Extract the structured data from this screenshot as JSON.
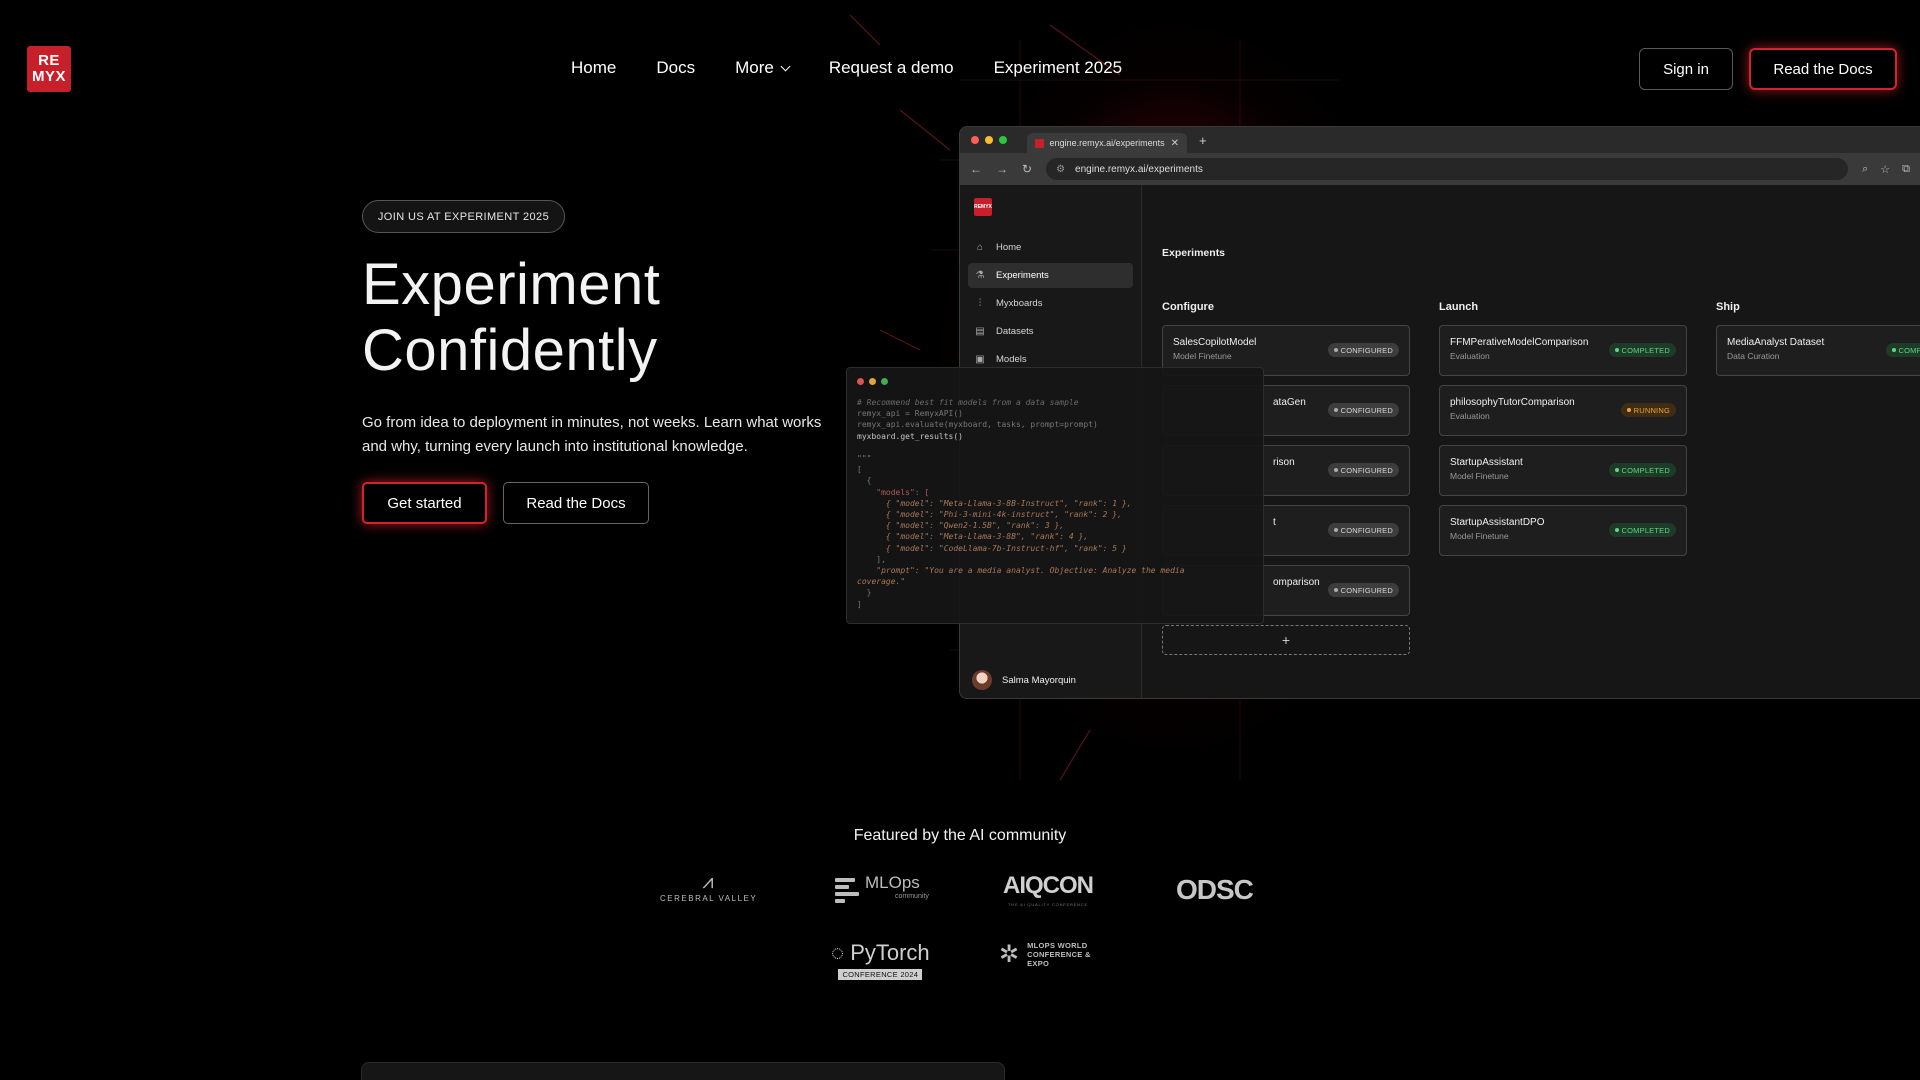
{
  "brand": {
    "logo_line1": "RE",
    "logo_line2": "MYX",
    "accent": "#d2232e"
  },
  "nav": {
    "items": [
      "Home",
      "Docs",
      "More",
      "Request a demo",
      "Experiment 2025"
    ],
    "sign_in": "Sign in",
    "read_docs": "Read the Docs"
  },
  "hero": {
    "pill": "JOIN US AT EXPERIMENT 2025",
    "title_line1": "Experiment",
    "title_line2": "Confidently",
    "subtitle": "Go from idea to deployment in minutes, not weeks. Learn what works and why, turning every launch into institutional knowledge.",
    "cta_primary": "Get started",
    "cta_secondary": "Read the Docs"
  },
  "browser": {
    "tab_title": "engine.remyx.ai/experiments",
    "url": "engine.remyx.ai/experiments",
    "app_logo_line1": "RE",
    "app_logo_line2": "MYX",
    "sidebar": [
      {
        "label": "Home",
        "icon": "home-icon"
      },
      {
        "label": "Experiments",
        "icon": "flask-icon"
      },
      {
        "label": "Myxboards",
        "icon": "sliders-icon"
      },
      {
        "label": "Datasets",
        "icon": "document-icon"
      },
      {
        "label": "Models",
        "icon": "cube-icon"
      }
    ],
    "user_name": "Salma Mayorquin",
    "page_title": "Experiments",
    "columns": {
      "configure": {
        "title": "Configure",
        "cards": [
          {
            "name": "SalesCopilotModel",
            "sub": "Model Finetune",
            "status": "CONFIGURED"
          },
          {
            "name": "ataGen",
            "sub": "",
            "status": "CONFIGURED"
          },
          {
            "name": "rison",
            "sub": "",
            "status": "CONFIGURED"
          },
          {
            "name": "t",
            "sub": "",
            "status": "CONFIGURED"
          },
          {
            "name": "omparison",
            "sub": "",
            "status": "CONFIGURED"
          }
        ],
        "add": "+"
      },
      "launch": {
        "title": "Launch",
        "cards": [
          {
            "name": "FFMPerativeModelComparison",
            "sub": "Evaluation",
            "status": "COMPLETED"
          },
          {
            "name": "philosophyTutorComparison",
            "sub": "Evaluation",
            "status": "RUNNING"
          },
          {
            "name": "StartupAssistant",
            "sub": "Model Finetune",
            "status": "COMPLETED"
          },
          {
            "name": "StartupAssistantDPO",
            "sub": "Model Finetune",
            "status": "COMPLETED"
          }
        ]
      },
      "ship": {
        "title": "Ship",
        "cards": [
          {
            "name": "MediaAnalyst Dataset",
            "sub": "Data Curation",
            "status": "COMPLETED"
          }
        ]
      }
    },
    "status_colors": {
      "configured": "#d8d8d8",
      "completed": "#5fd683",
      "running": "#f0a33a"
    }
  },
  "code": {
    "l1": "# Recommend best fit models from a data sample",
    "l2": "remyx_api = RemyxAPI()",
    "l3": "remyx_api.evaluate(myxboard, tasks, prompt=prompt)",
    "l4": "myxboard.get_results()",
    "l5": "\"\"\"",
    "l6": "[",
    "l7": "  {",
    "l8": "    \"models\": [",
    "m1": "      { \"model\": \"Meta-Llama-3-8B-Instruct\", \"rank\": 1 },",
    "m2": "      { \"model\": \"Phi-3-mini-4k-instruct\", \"rank\": 2 },",
    "m3": "      { \"model\": \"Qwen2-1.5B\", \"rank\": 3 },",
    "m4": "      { \"model\": \"Meta-Llama-3-8B\", \"rank\": 4 },",
    "m5": "      { \"model\": \"CodeLlama-7b-Instruct-hf\", \"rank\": 5 }",
    "l9": "    ],",
    "l10": "    \"prompt\": \"You are a media analyst. Objective: Analyze the media",
    "l11": "coverage.\"",
    "l12": "  }",
    "l13": "]"
  },
  "featured": {
    "heading": "Featured by the AI community",
    "logos": {
      "cerebral_valley": "CEREBRAL VALLEY",
      "mlops_1": "MLOps",
      "mlops_2": "community",
      "aiqcon": "AIQCON",
      "aiqcon_sub": "THE AI QUALITY CONFERENCE",
      "odsc": "ODSC",
      "pytorch_1": "PyTorch",
      "pytorch_2": "CONFERENCE 2024",
      "mlops_world_1": "MLOPS WORLD",
      "mlops_world_2": "CONFERENCE &",
      "mlops_world_3": "EXPO"
    }
  }
}
